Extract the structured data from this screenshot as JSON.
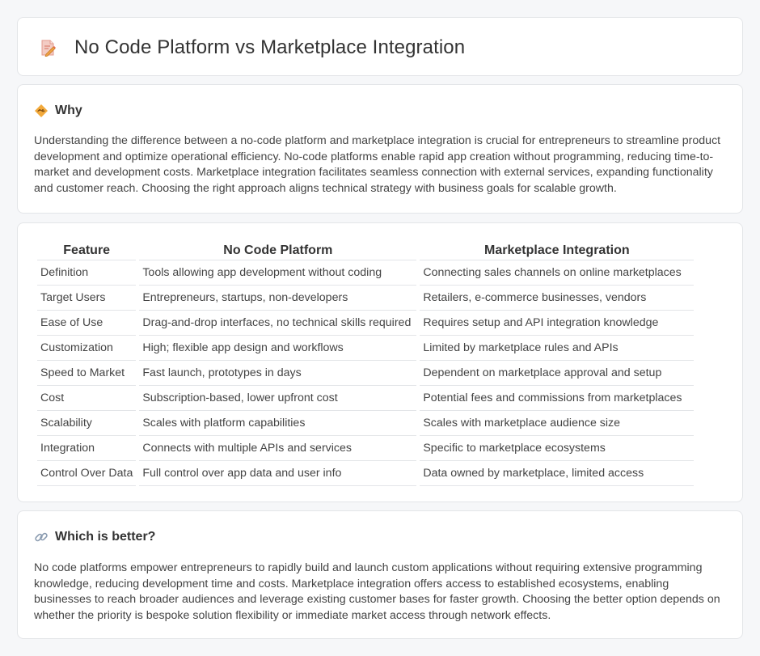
{
  "header": {
    "title": "No Code Platform vs Marketplace Integration",
    "icon": "document-pencil-icon"
  },
  "why": {
    "heading": "Why",
    "icon": "handshake-icon",
    "text": "Understanding the difference between a no-code platform and marketplace integration is crucial for entrepreneurs to streamline product development and optimize operational efficiency. No-code platforms enable rapid app creation without programming, reducing time-to-market and development costs. Marketplace integration facilitates seamless connection with external services, expanding functionality and customer reach. Choosing the right approach aligns technical strategy with business goals for scalable growth."
  },
  "table": {
    "headers": [
      "Feature",
      "No Code Platform",
      "Marketplace Integration"
    ],
    "rows": [
      [
        "Definition",
        "Tools allowing app development without coding",
        "Connecting sales channels on online marketplaces"
      ],
      [
        "Target Users",
        "Entrepreneurs, startups, non-developers",
        "Retailers, e-commerce businesses, vendors"
      ],
      [
        "Ease of Use",
        "Drag-and-drop interfaces, no technical skills required",
        "Requires setup and API integration knowledge"
      ],
      [
        "Customization",
        "High; flexible app design and workflows",
        "Limited by marketplace rules and APIs"
      ],
      [
        "Speed to Market",
        "Fast launch, prototypes in days",
        "Dependent on marketplace approval and setup"
      ],
      [
        "Cost",
        "Subscription-based, lower upfront cost",
        "Potential fees and commissions from marketplaces"
      ],
      [
        "Scalability",
        "Scales with platform capabilities",
        "Scales with marketplace audience size"
      ],
      [
        "Integration",
        "Connects with multiple APIs and services",
        "Specific to marketplace ecosystems"
      ],
      [
        "Control Over Data",
        "Full control over app data and user info",
        "Data owned by marketplace, limited access"
      ]
    ]
  },
  "better": {
    "heading": "Which is better?",
    "icon": "link-icon",
    "text": "No code platforms empower entrepreneurs to rapidly build and launch custom applications without requiring extensive programming knowledge, reducing development time and costs. Marketplace integration offers access to established ecosystems, enabling businesses to reach broader audiences and leverage existing customer bases for faster growth. Choosing the better option depends on whether the priority is bespoke solution flexibility or immediate market access through network effects."
  }
}
